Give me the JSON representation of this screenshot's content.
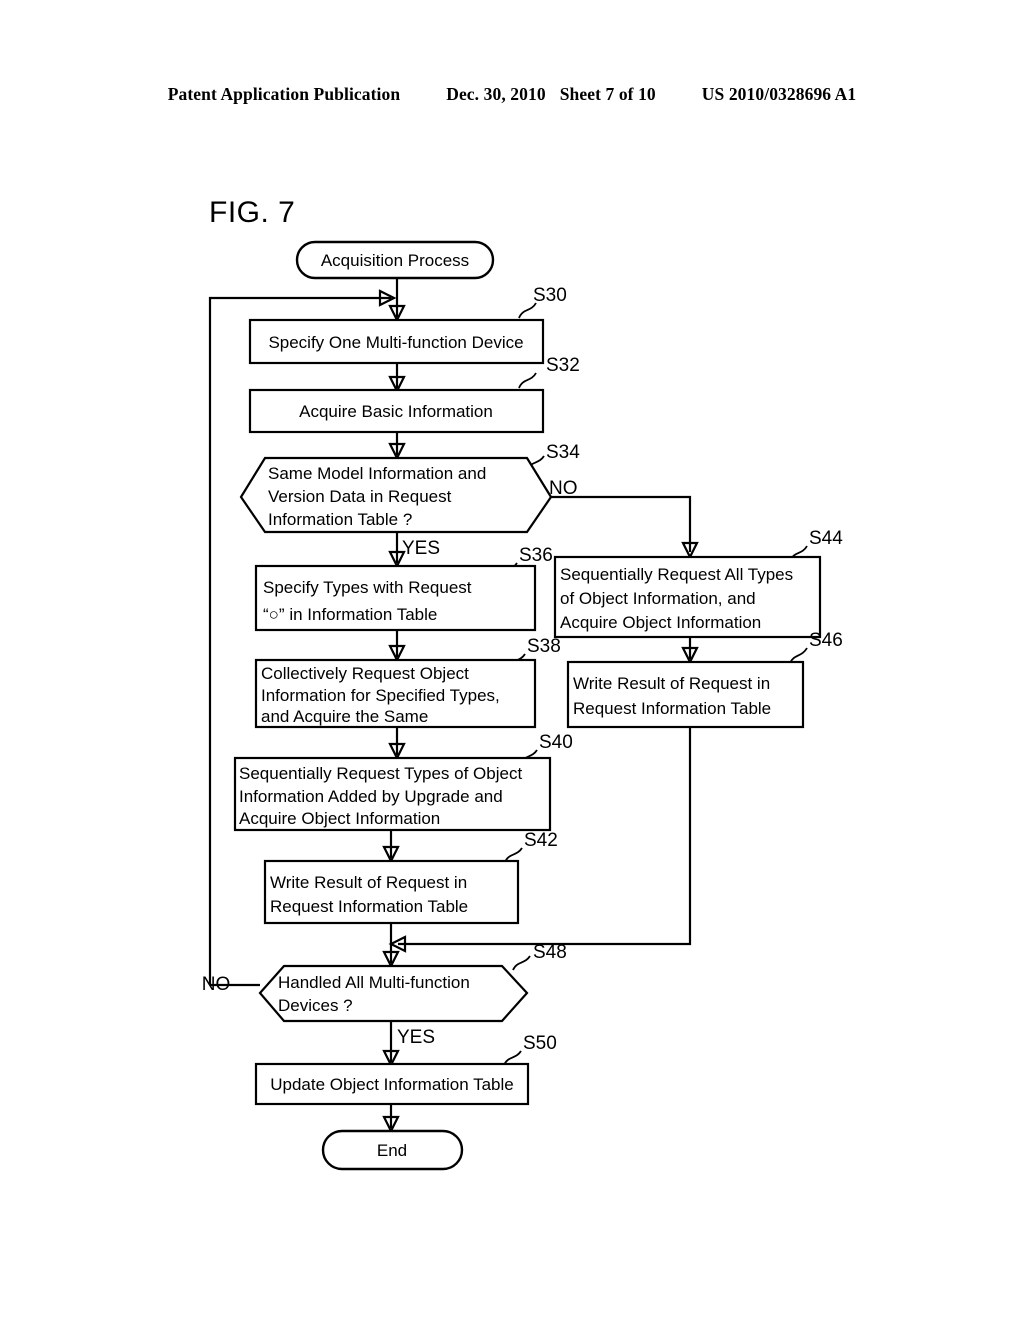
{
  "header": {
    "publication": "Patent Application Publication",
    "date": "Dec. 30, 2010",
    "sheet": "Sheet 7 of 10",
    "number": "US 2010/0328696 A1"
  },
  "figure": {
    "title": "FIG. 7"
  },
  "flowchart": {
    "start_label": "Acquisition Process",
    "end_label": "End",
    "nodes": {
      "s30": {
        "id": "S30",
        "lines": [
          "Specify One Multi-function Device"
        ]
      },
      "s32": {
        "id": "S32",
        "lines": [
          "Acquire Basic Information"
        ]
      },
      "s34": {
        "id": "S34",
        "lines": [
          "Same Model Information and",
          "Version Data in Request",
          "Information Table ?"
        ]
      },
      "s36": {
        "id": "S36",
        "lines": [
          "Specify Types with Request",
          "“○” in Information Table"
        ]
      },
      "s38": {
        "id": "S38",
        "lines": [
          "Collectively Request Object",
          "Information for Specified Types,",
          "and Acquire the Same"
        ]
      },
      "s40": {
        "id": "S40",
        "lines": [
          "Sequentially Request Types of Object",
          "Information Added by Upgrade and",
          "Acquire Object Information"
        ]
      },
      "s42": {
        "id": "S42",
        "lines": [
          "Write Result of Request in",
          "Request Information Table"
        ]
      },
      "s44": {
        "id": "S44",
        "lines": [
          "Sequentially Request All Types",
          "of Object Information, and",
          "Acquire Object Information"
        ]
      },
      "s46": {
        "id": "S46",
        "lines": [
          "Write Result of Request in",
          "Request Information Table"
        ]
      },
      "s48": {
        "id": "S48",
        "lines": [
          "Handled All Multi-function",
          "Devices ?"
        ]
      },
      "s50": {
        "id": "S50",
        "lines": [
          "Update Object Information Table"
        ]
      }
    },
    "branch_labels": {
      "s34_no": "NO",
      "s34_yes": "YES",
      "s48_no": "NO",
      "s48_yes": "YES"
    }
  },
  "colors": {
    "ink": "#000000",
    "paper": "#ffffff"
  }
}
